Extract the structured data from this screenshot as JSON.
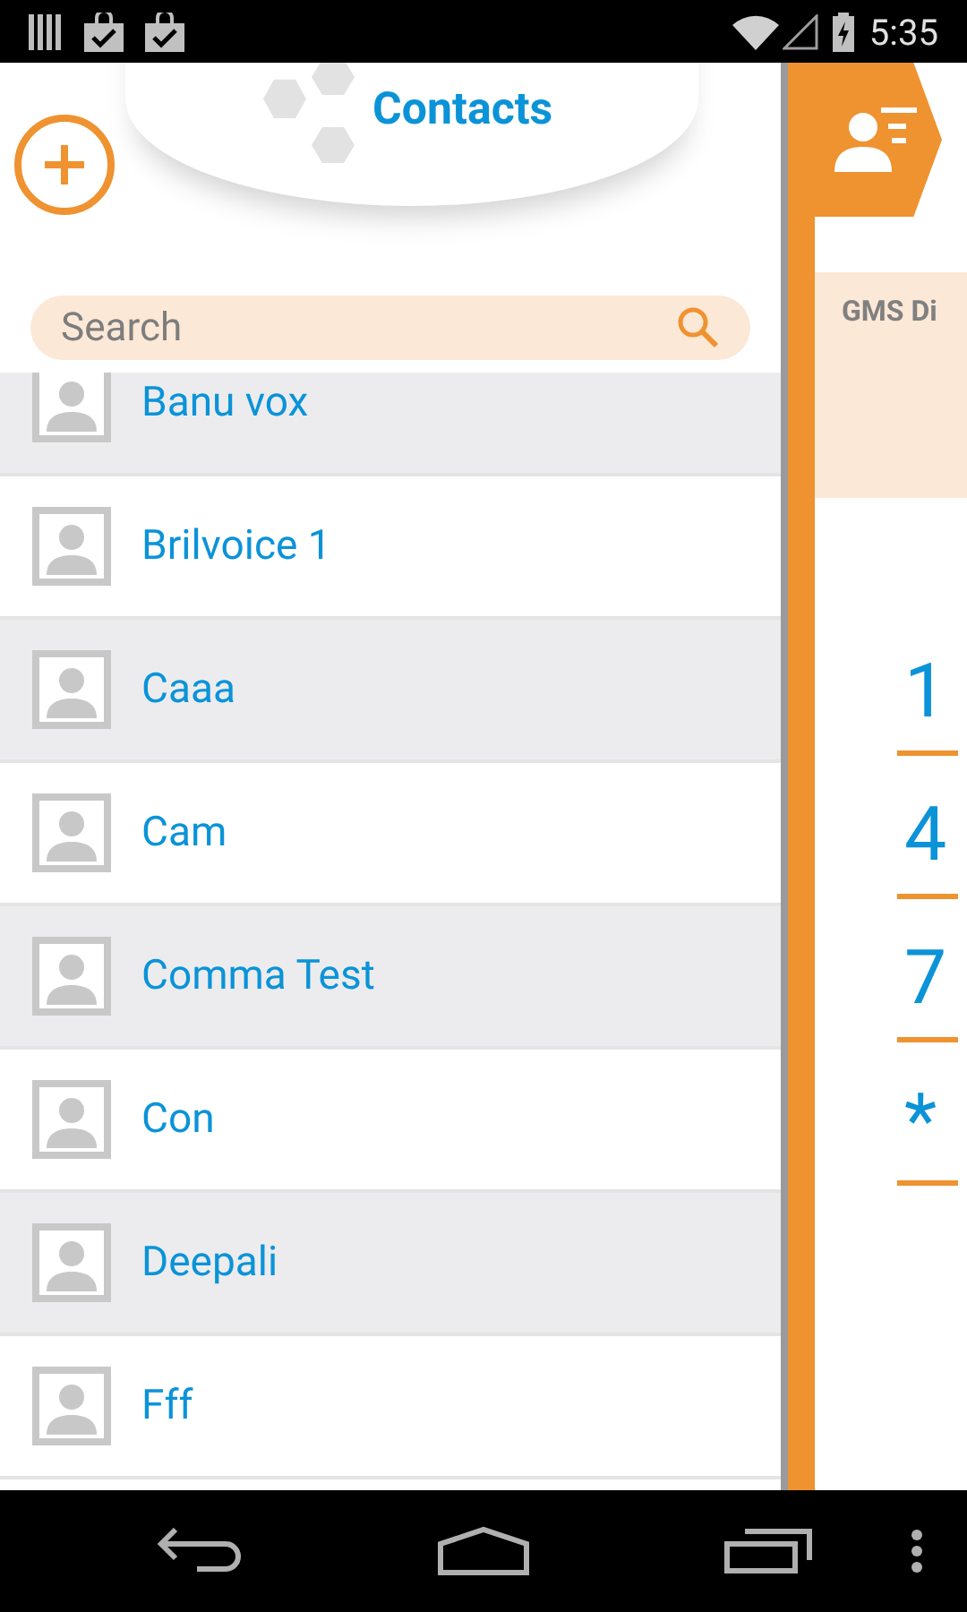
{
  "status_bar": {
    "time": "5:35"
  },
  "header": {
    "title": "Contacts"
  },
  "search": {
    "placeholder": "Search"
  },
  "contacts": [
    {
      "name": "Banu vox"
    },
    {
      "name": "Brilvoice 1"
    },
    {
      "name": "Caaa"
    },
    {
      "name": "Cam"
    },
    {
      "name": "Comma Test"
    },
    {
      "name": "Con"
    },
    {
      "name": "Deepali"
    },
    {
      "name": "Fff"
    }
  ],
  "dialer": {
    "label": "GMS Di",
    "keys": [
      "1",
      "4",
      "7",
      "*"
    ]
  }
}
